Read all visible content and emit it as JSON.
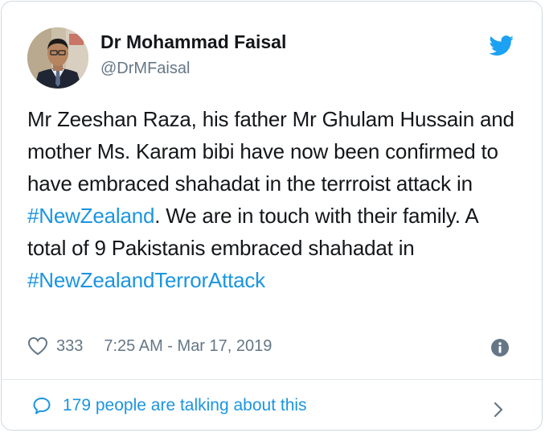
{
  "author": {
    "display_name": "Dr Mohammad Faisal",
    "handle": "@DrMFaisal",
    "avatar_icon": "profile-photo"
  },
  "tweet": {
    "text_part1": "Mr Zeeshan Raza, his father Mr Ghulam Hussain and mother Ms. Karam bibi have now been confirmed to have embraced shahadat in the terrroist attack in ",
    "hashtag1": "#NewZealand",
    "text_part2": ". We are in touch with their family. A total of 9 Pakistanis embraced shahadat in ",
    "hashtag2": "#NewZealandTerrorAttack"
  },
  "meta": {
    "like_icon": "heart-icon",
    "like_count": "333",
    "timestamp": "7:25 AM - Mar 17, 2019",
    "info_icon": "info-icon"
  },
  "footer": {
    "comment_icon": "speech-bubble-icon",
    "talking_text": "179 people are talking about this",
    "chevron_icon": "chevron-right-icon"
  },
  "colors": {
    "link": "#1b95e0",
    "secondary_text": "#657786",
    "twitter_blue": "#1da1f2",
    "border": "#cfd9de"
  }
}
